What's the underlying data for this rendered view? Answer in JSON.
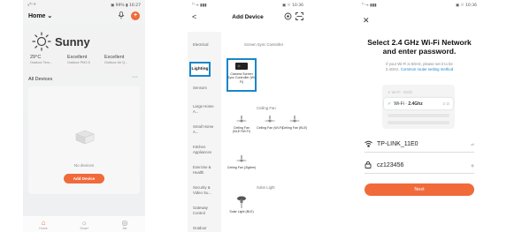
{
  "phone1": {
    "status_left": "√ᵀˡ ᵂ",
    "status_right": "▣ 99% ▮ 16:27",
    "home_title": "Home ⌄",
    "mic_icon": "mic-icon",
    "add_icon_text": "+",
    "weather": "Sunny",
    "stats": [
      {
        "value": "29°C",
        "label": "Outdoor Tem..."
      },
      {
        "value": "Excellent",
        "label": "Outdoor PM2.5"
      },
      {
        "value": "Excellent",
        "label": "Outdoor Air Q..."
      }
    ],
    "all_devices": "All Devices",
    "more": "···",
    "no_devices": "No devices",
    "add_device": "Add Device",
    "tabs": [
      {
        "label": "Home",
        "icon": "home-icon",
        "glyph": "⌂"
      },
      {
        "label": "Smart",
        "icon": "sun-icon",
        "glyph": "☼"
      },
      {
        "label": "Me",
        "icon": "me-icon",
        "glyph": "◎"
      }
    ],
    "accent": "#f06a3a"
  },
  "phone2": {
    "status_left": "ᵀˡ → ▮▮▮",
    "status_right": "▣ ☉ 10:36",
    "back": "<",
    "title": "Add Device",
    "categories": [
      "Electrical",
      "Lighting",
      "Sensors",
      "Large Home A...",
      "Small Home A...",
      "Kitchen Appliances",
      "Exercise & Health",
      "Security & Video Su...",
      "Gateway Control",
      "Outdoor"
    ],
    "sections": {
      "screen_sync": "Screen Sync Controller",
      "ceiling_fan": "Ceiling Fan",
      "solar_light": "Solar Light"
    },
    "products": {
      "camera": "Camera Screen Sync Controller (Wi-Fi)",
      "fan1": "Ceiling Fan (BLE+Wi-Fi)",
      "fan2": "Ceiling Fan (Wi-Fi)",
      "fan3": "Ceiling Fan (BLE)",
      "fan4": "Ceiling Fan (Zigbee)",
      "solar": "Solar Light (BLE)"
    },
    "highlight": "#1a86c8"
  },
  "phone3": {
    "status_left": "ᵀˡ → ▮▮▮",
    "status_right": "▣ ☉ 10:36",
    "close": "✕",
    "heading_line1": "Select 2.4 GHz Wi-Fi Network",
    "heading_line2": "and enter password.",
    "sub_line1": "If your Wi-Fi is 5GHz, please set it to be",
    "sub_line2_prefix": "2.4GHz.",
    "sub_link": "Common router setting method",
    "wifi_5g": "✕ Wi-Fi · 5Ghz",
    "wifi_24_prefix": "Wi-Fi ·",
    "wifi_24": "2.4Ghz",
    "wifi_24_icons": "≡ ⊙",
    "ssid": "TP-LINK_11E0",
    "ssid_right": "⇄",
    "password": "cz123456",
    "password_right": "◉",
    "next": "Next"
  }
}
